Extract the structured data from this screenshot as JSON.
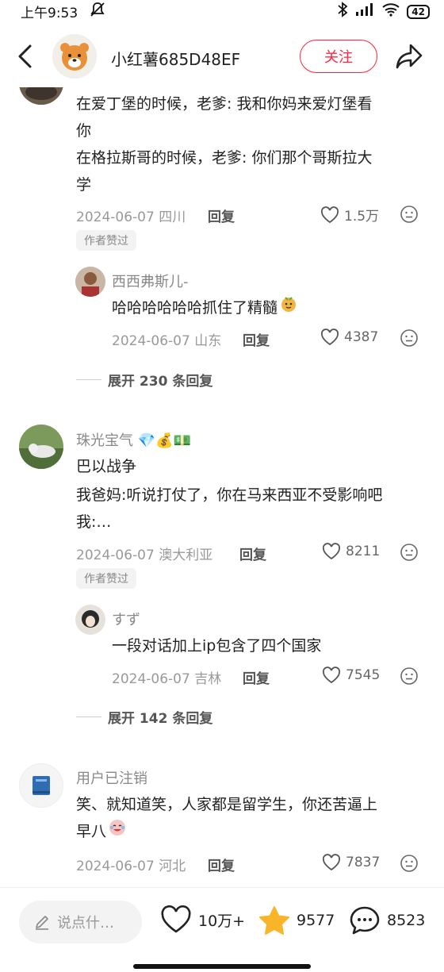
{
  "status_bar": {
    "time": "上午9:53",
    "battery": "42"
  },
  "header": {
    "username": "小红薯685D48EF",
    "follow_label": "关注"
  },
  "comments": [
    {
      "lines": [
        "在爱丁堡的时候，老爹: 我和你妈来爱灯堡看",
        "你",
        "在格拉斯哥的时候，老爹: 你们那个哥斯拉大",
        "学"
      ],
      "date_loc": "2024-06-07 四川",
      "reply_label": "回复",
      "likes": "1.5万",
      "author_badge": "作者赞过",
      "sub_reply": {
        "name": "西西弗斯儿-",
        "text": "哈哈哈哈哈哈抓住了精髓",
        "date_loc": "2024-06-07 山东",
        "reply_label": "回复",
        "likes": "4387"
      },
      "expand": "展开 230 条回复"
    },
    {
      "name": "珠光宝气",
      "lines": [
        "巴以战争",
        "我爸妈:听说打仗了，你在马来西亚不受影响吧",
        "我:…"
      ],
      "date_loc": "2024-06-07 澳大利亚",
      "reply_label": "回复",
      "likes": "8211",
      "author_badge": "作者赞过",
      "sub_reply": {
        "name": "すず",
        "text": "一段对话加上ip包含了四个国家",
        "date_loc": "2024-06-07 吉林",
        "reply_label": "回复",
        "likes": "7545"
      },
      "expand": "展开 142 条回复"
    },
    {
      "name": "用户已注销",
      "lines": [
        "笑、就知道笑，人家都是留学生，你还苦逼上",
        "早八"
      ],
      "date_loc": "2024-06-07 河北",
      "reply_label": "回复",
      "likes": "7837"
    }
  ],
  "bottom_bar": {
    "input_placeholder": "说点什…",
    "likes": "10万+",
    "collects": "9577",
    "comments": "8523"
  },
  "colors": {
    "accent": "#ff2442",
    "star": "#f9b52a"
  }
}
